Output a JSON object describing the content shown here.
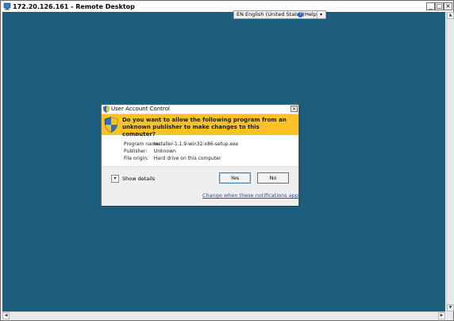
{
  "window": {
    "title": "172.20.126.161 - Remote Desktop",
    "controls": {
      "minimize": "_",
      "maximize": "□",
      "close": "×"
    }
  },
  "language_bar": {
    "language": "EN English (United States)",
    "help_label": "Help",
    "options_glyph": "▾"
  },
  "dialog": {
    "title": "User Account Control",
    "close_glyph": "×",
    "question": "Do you want to allow the following program from an unknown publisher to make changes to this computer?",
    "details": [
      {
        "label": "Program name:",
        "value": "installer-1.1.9-win32-x86-setup.exe"
      },
      {
        "label": "Publisher:",
        "value": "Unknown"
      },
      {
        "label": "File origin:",
        "value": "Hard drive on this computer"
      }
    ],
    "show_details_label": "Show details",
    "show_details_glyph": "▾",
    "yes_label": "Yes",
    "no_label": "No",
    "settings_link": "Change when these notifications appear"
  },
  "colors": {
    "desktop": "#1d5d7d",
    "banner": "#fcc228",
    "link": "#1f53a0"
  },
  "icons": [
    "remote-desktop-icon",
    "shield-icon",
    "help-icon"
  ]
}
